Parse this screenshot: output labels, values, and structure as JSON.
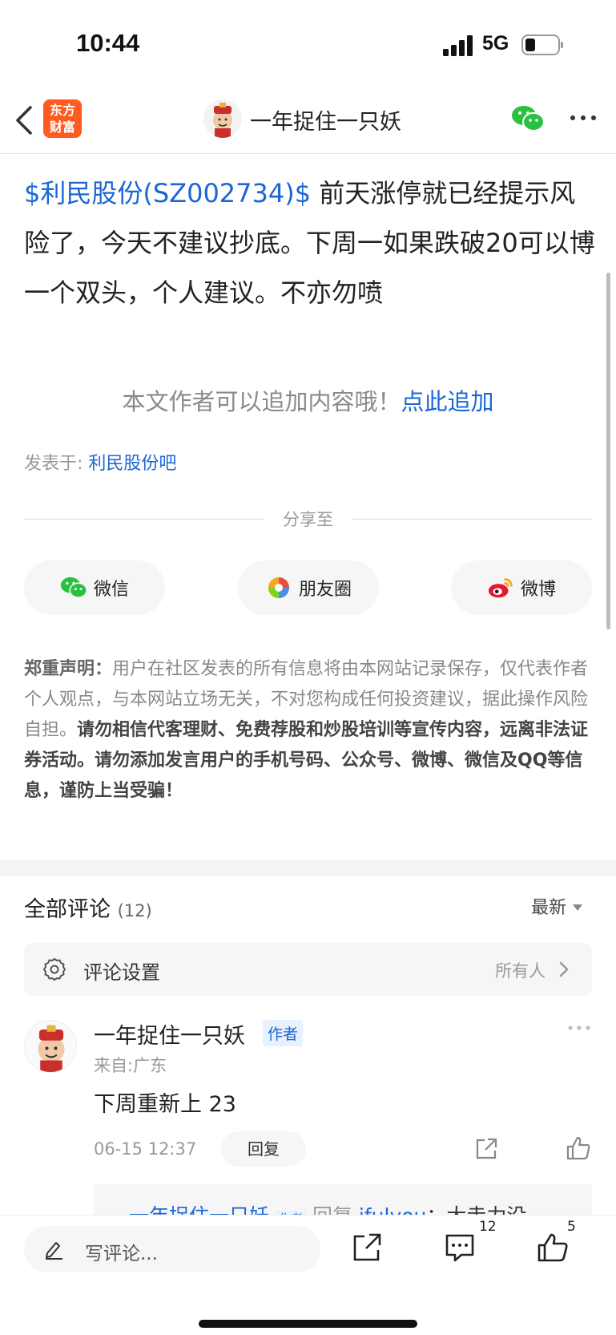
{
  "status_bar": {
    "time": "10:44",
    "network": "5G"
  },
  "nav": {
    "brand_line1": "东方",
    "brand_line2": "财富",
    "title": "一年捉住一只妖"
  },
  "article": {
    "stock_tag": "$利民股份(SZ002734)$",
    "body": " 前天涨停就已经提示风险了，今天不建议抄底。下周一如果跌破20可以博一个双头，个人建议。不亦勿喷",
    "append_hint": "本文作者可以追加内容哦！",
    "append_link": "点此追加",
    "posted_label": "发表于: ",
    "posted_link": "利民股份吧"
  },
  "share": {
    "label": "分享至",
    "buttons": [
      {
        "label": "微信",
        "icon": "wechat-icon"
      },
      {
        "label": "朋友圈",
        "icon": "moments-icon"
      },
      {
        "label": "微博",
        "icon": "weibo-icon"
      }
    ]
  },
  "disclaimer": {
    "lead": "郑重声明：",
    "normal": "用户在社区发表的所有信息将由本网站记录保存，仅代表作者个人观点，与本网站立场无关，不对您构成任何投资建议，据此操作风险自担。",
    "bold": "请勿相信代客理财、免费荐股和炒股培训等宣传内容，远离非法证券活动。请勿添加发言用户的手机号码、公众号、微博、微信及QQ等信息，谨防上当受骗！"
  },
  "comments": {
    "title": "全部评论",
    "count": "(12)",
    "sort": "最新",
    "settings_label": "评论设置",
    "settings_value": "所有人",
    "items": [
      {
        "author": "一年捉住一只妖",
        "badge": "作者",
        "from": "来自:广东",
        "text": "下周重新上 23",
        "time": "06-15 12:37",
        "reply_label": "回复"
      }
    ],
    "sub_reply": {
      "author": "一年捉住一只妖",
      "badge": "作者",
      "reply_word": "回复",
      "target": "ifulyou",
      "text": "：大走力没"
    }
  },
  "bottom_bar": {
    "input_placeholder": "写评论...",
    "comment_count": "12",
    "like_count": "5"
  },
  "colors": {
    "accent": "#1a66d6",
    "brand": "#ff5a1f",
    "wechat": "#2ac140",
    "weibo": "#e6162d"
  }
}
